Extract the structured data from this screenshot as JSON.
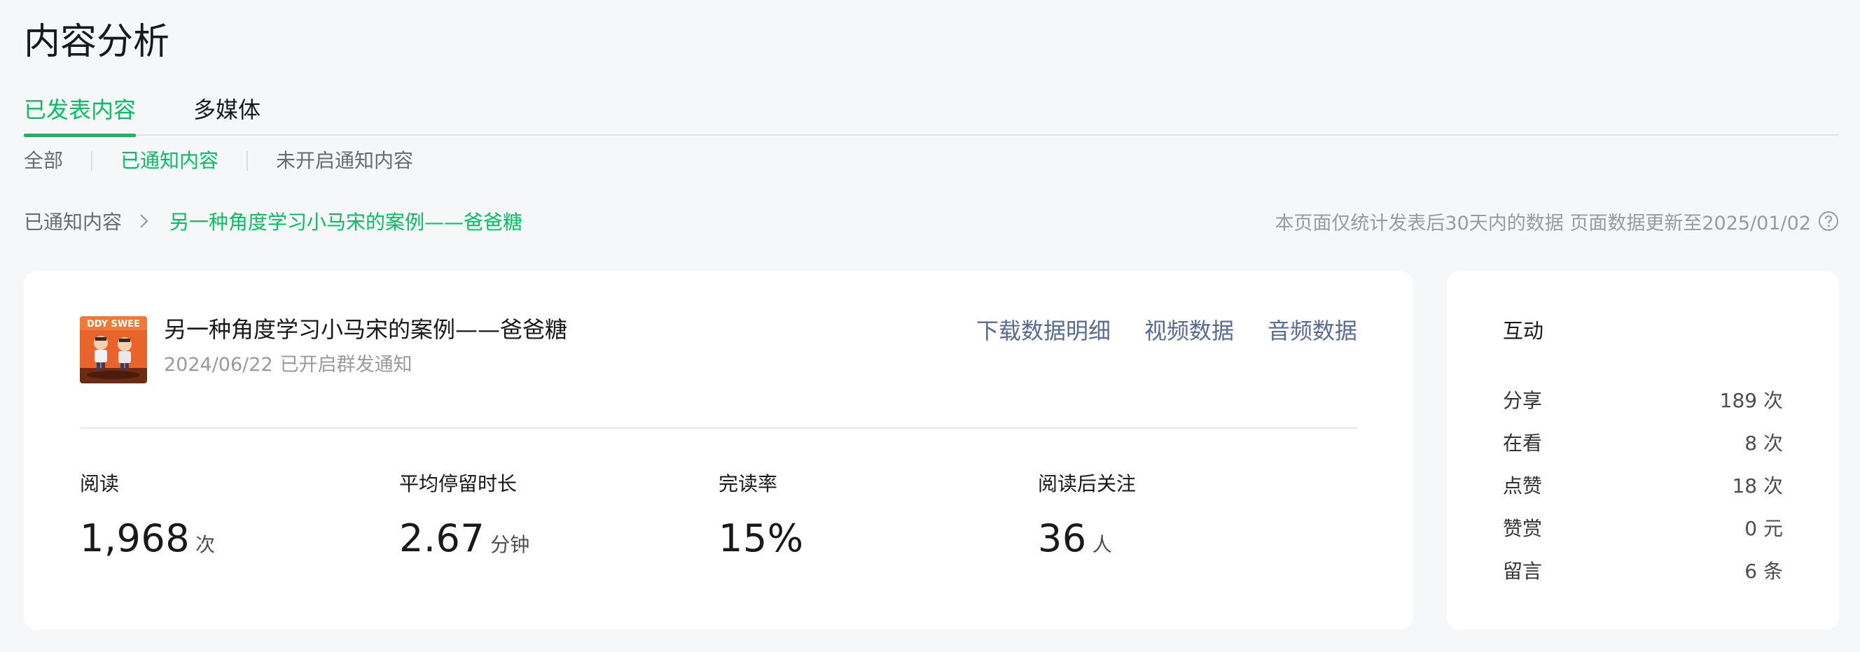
{
  "page": {
    "title": "内容分析"
  },
  "tabs": [
    {
      "label": "已发表内容",
      "active": true
    },
    {
      "label": "多媒体",
      "active": false
    }
  ],
  "filters": [
    {
      "label": "全部",
      "active": false
    },
    {
      "label": "已通知内容",
      "active": true
    },
    {
      "label": "未开启通知内容",
      "active": false
    }
  ],
  "breadcrumb": {
    "root": "已通知内容",
    "current": "另一种角度学习小马宋的案例——爸爸糖"
  },
  "notice": {
    "text": "本页面仅统计发表后30天内的数据 页面数据更新至2025/01/02",
    "icon": "question-circle-icon"
  },
  "article": {
    "title": "另一种角度学习小马宋的案例——爸爸糖",
    "date": "2024/06/22",
    "status": "已开启群发通知",
    "thumbnail_text": "DDY SWEE"
  },
  "actions": [
    {
      "label": "下载数据明细"
    },
    {
      "label": "视频数据"
    },
    {
      "label": "音频数据"
    }
  ],
  "stats": [
    {
      "label": "阅读",
      "value": "1,968",
      "unit": "次"
    },
    {
      "label": "平均停留时长",
      "value": "2.67",
      "unit": "分钟"
    },
    {
      "label": "完读率",
      "value": "15%",
      "unit": ""
    },
    {
      "label": "阅读后关注",
      "value": "36",
      "unit": "人"
    }
  ],
  "interaction": {
    "title": "互动",
    "rows": [
      {
        "label": "分享",
        "value": "189 次"
      },
      {
        "label": "在看",
        "value": "8 次"
      },
      {
        "label": "点赞",
        "value": "18 次"
      },
      {
        "label": "赞赏",
        "value": "0 元"
      },
      {
        "label": "留言",
        "value": "6 条"
      }
    ]
  },
  "colors": {
    "accent": "#07c160",
    "link": "#576b95",
    "background": "#f6f7f8"
  }
}
